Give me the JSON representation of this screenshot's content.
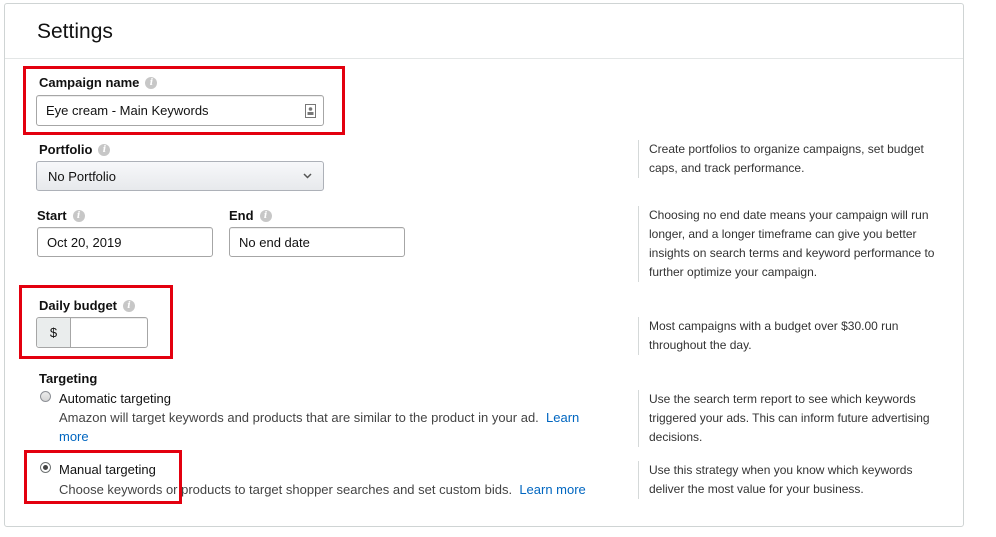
{
  "title": "Settings",
  "campaign": {
    "label": "Campaign name",
    "value": "Eye cream - Main Keywords"
  },
  "portfolio": {
    "label": "Portfolio",
    "selected": "No Portfolio",
    "help": "Create portfolios to organize campaigns, set budget caps, and track performance."
  },
  "dates": {
    "start_label": "Start",
    "start_value": "Oct 20, 2019",
    "end_label": "End",
    "end_value": "No end date",
    "help": "Choosing no end date means your campaign will run longer, and a longer timeframe can give you better insights on search terms and keyword performance to further optimize your campaign."
  },
  "budget": {
    "label": "Daily budget",
    "currency": "$",
    "value": "",
    "help": "Most campaigns with a budget over $30.00 run throughout the day."
  },
  "targeting": {
    "label": "Targeting",
    "automatic": {
      "title": "Automatic targeting",
      "desc": "Amazon will target keywords and products that are similar to the product in your ad.",
      "link": "Learn more",
      "checked": false,
      "help": "Use the search term report to see which keywords triggered your ads. This can inform future advertising decisions."
    },
    "manual": {
      "title": "Manual targeting",
      "desc": "Choose keywords or products to target shopper searches and set custom bids.",
      "link": "Learn more",
      "checked": true,
      "help": "Use this strategy when you know which keywords deliver the most value for your business."
    }
  },
  "colors": {
    "highlight": "#e3000f",
    "link": "#0066c0"
  },
  "icons": {
    "info": "info-icon",
    "contact_card": "contact-card-icon",
    "chevron": "chevron-down-icon"
  }
}
